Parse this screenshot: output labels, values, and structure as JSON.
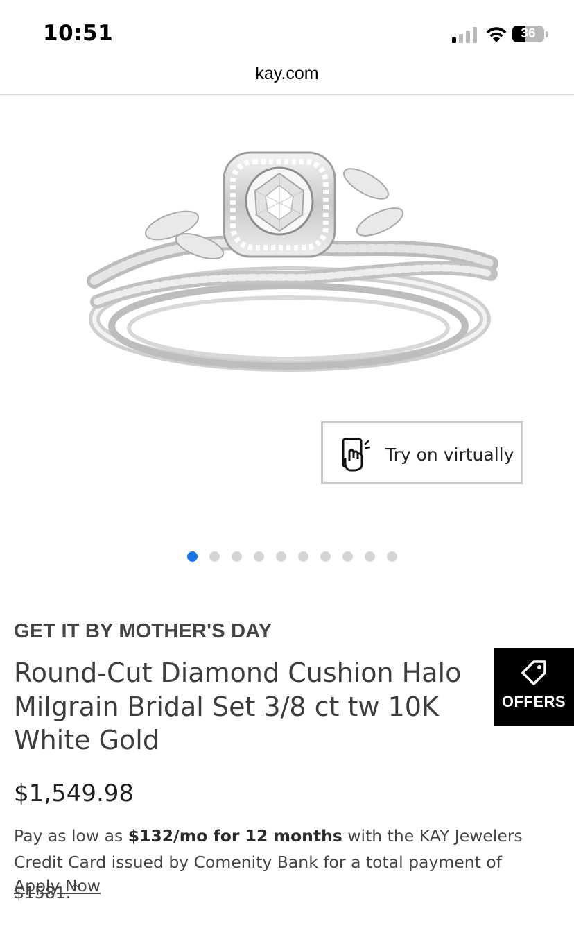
{
  "status_bar": {
    "time": "10:51",
    "battery": "36"
  },
  "browser": {
    "url": "kay.com"
  },
  "product": {
    "image_icon": "ring-image",
    "try_on_label": "Try on virtually",
    "carousel_total": 10,
    "carousel_active": 1,
    "promo": "GET IT BY MOTHER'S DAY",
    "title": "Round-Cut Diamond Cushion Halo Milgrain Bridal Set 3/8 ct tw 10K White Gold",
    "price": "$1,549.98"
  },
  "financing": {
    "prefix": "Pay as low as ",
    "highlight": "$132/mo for 12 months",
    "suffix": " with the KAY Jewelers Credit Card issued by Comenity Bank for a total payment of $1581.",
    "footnote": "^",
    "apply_label": "Apply Now"
  },
  "offers": {
    "label": "OFFERS",
    "icon": "tag-icon"
  },
  "colors": {
    "accent": "#1a73e8",
    "offers_bg": "#000000",
    "dot_inactive": "#d4d4d4"
  }
}
